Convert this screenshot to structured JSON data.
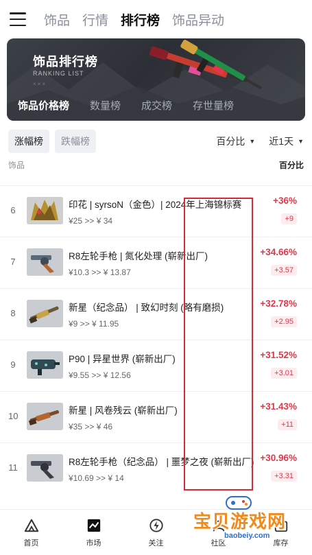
{
  "topnav": {
    "tabs": [
      {
        "label": "饰品"
      },
      {
        "label": "行情"
      },
      {
        "label": "排行榜"
      },
      {
        "label": "饰品异动"
      }
    ]
  },
  "banner": {
    "title": "饰品排行榜",
    "subtitle": "RANKING LIST",
    "marks": "×××",
    "tabs": [
      {
        "label": "饰品价格榜"
      },
      {
        "label": "数量榜"
      },
      {
        "label": "成交榜"
      },
      {
        "label": "存世量榜"
      }
    ]
  },
  "filters": {
    "rise": "涨幅榜",
    "fall": "跌幅榜",
    "metric": "百分比",
    "period": "近1天"
  },
  "columns": {
    "item": "饰品",
    "percent": "百分比"
  },
  "items": [
    {
      "rank": "6",
      "name": "印花 | syrsoN（金色）| 2024年上海锦标赛",
      "price": "¥25 >> ¥ 34",
      "pct": "+36%",
      "delta": "+9",
      "thumb": "sticker"
    },
    {
      "rank": "7",
      "name": "R8左轮手枪 | 氮化处理 (崭新出厂)",
      "price": "¥10.3 >> ¥ 13.87",
      "pct": "+34.66%",
      "delta": "+3.57",
      "thumb": "revolver"
    },
    {
      "rank": "8",
      "name": "新星（纪念品） | 致幻时刻 (略有磨损)",
      "price": "¥9 >> ¥ 11.95",
      "pct": "+32.78%",
      "delta": "+2.95",
      "thumb": "shotgun"
    },
    {
      "rank": "9",
      "name": "P90 | 异星世界 (崭新出厂)",
      "price": "¥9.55 >> ¥ 12.56",
      "pct": "+31.52%",
      "delta": "+3.01",
      "thumb": "smg"
    },
    {
      "rank": "10",
      "name": "新星 | 风卷残云 (崭新出厂)",
      "price": "¥35 >> ¥ 46",
      "pct": "+31.43%",
      "delta": "+11",
      "thumb": "shotgun2"
    },
    {
      "rank": "11",
      "name": "R8左轮手枪（纪念品） | 噩梦之夜 (崭新出厂)",
      "price": "¥10.69 >> ¥ 14",
      "pct": "+30.96%",
      "delta": "+3.31",
      "thumb": "revolver2"
    }
  ],
  "bottomnav": [
    {
      "label": "首页",
      "icon": "home-icon"
    },
    {
      "label": "市场",
      "icon": "market-chart-icon"
    },
    {
      "label": "关注",
      "icon": "follow-bolt-icon"
    },
    {
      "label": "社区",
      "icon": "community-icon"
    },
    {
      "label": "库存",
      "icon": "inventory-icon"
    }
  ],
  "watermark": {
    "text": "宝贝游戏网",
    "url": "baobeiy.com"
  },
  "colors": {
    "accent_red": "#e0384a",
    "highlight_box": "#d42a35",
    "banner_bg": "#2c2f35"
  }
}
